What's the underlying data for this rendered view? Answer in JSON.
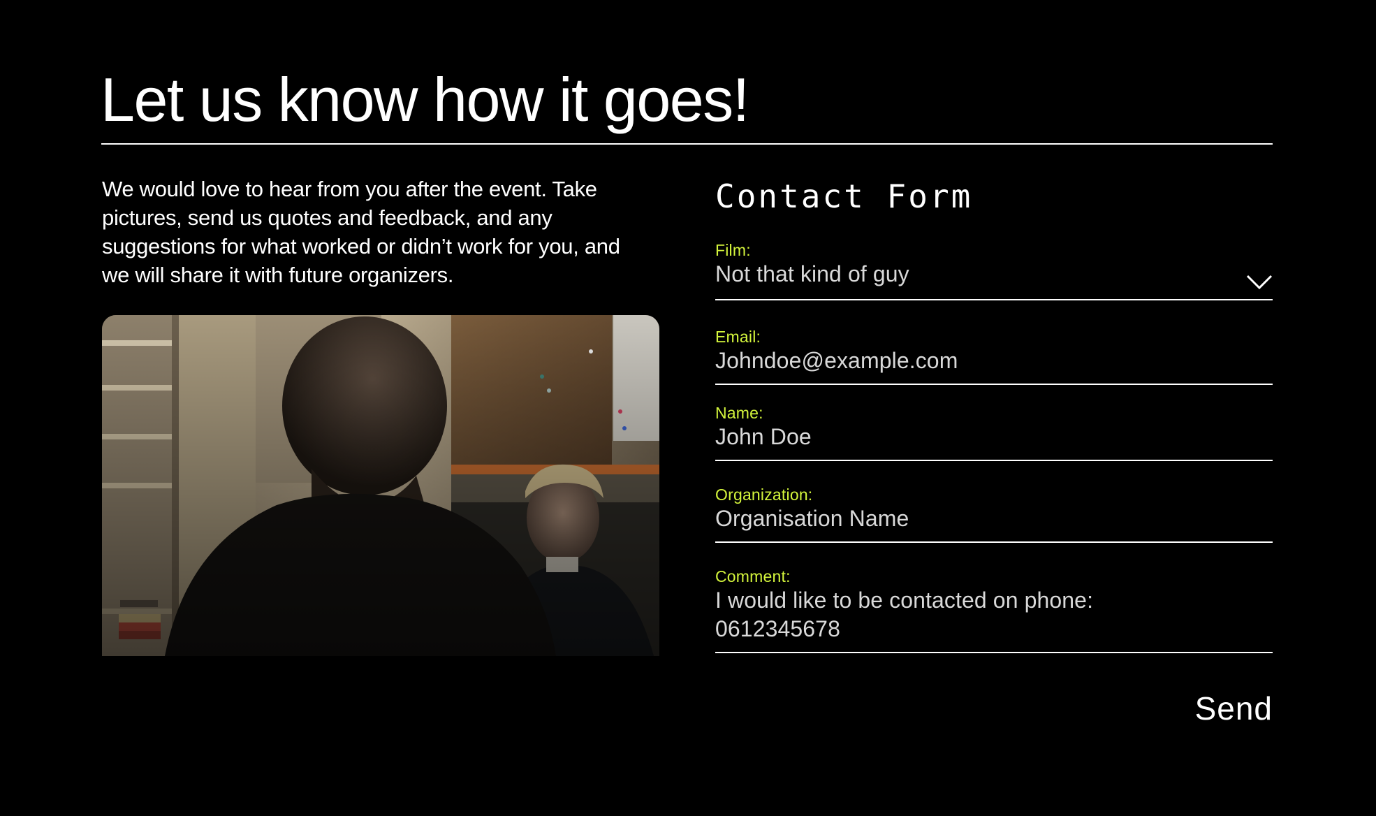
{
  "header": {
    "title": "Let us know how it goes!"
  },
  "intro": {
    "text": "We would love to hear from you after the event. Take pictures, send us quotes and feedback, and any suggestions for what worked or didn’t work for you, and we will share it with future organizers."
  },
  "form": {
    "title": "Contact Form",
    "fields": {
      "film": {
        "label": "Film:",
        "value": "Not that kind of guy"
      },
      "email": {
        "label": "Email:",
        "value": "Johndoe@example.com"
      },
      "name": {
        "label": "Name:",
        "value": "John Doe"
      },
      "organization": {
        "label": "Organization:",
        "value": "Organisation Name"
      },
      "comment": {
        "label": "Comment:",
        "value": "I would like to be contacted on phone:\n0612345678"
      }
    },
    "send_label": "Send"
  },
  "icons": {
    "film_dropdown": "chevron-down-icon"
  },
  "colors": {
    "background": "#000000",
    "text": "#ffffff",
    "field_value": "#d9d9d9",
    "label_accent": "#d4f53c"
  }
}
